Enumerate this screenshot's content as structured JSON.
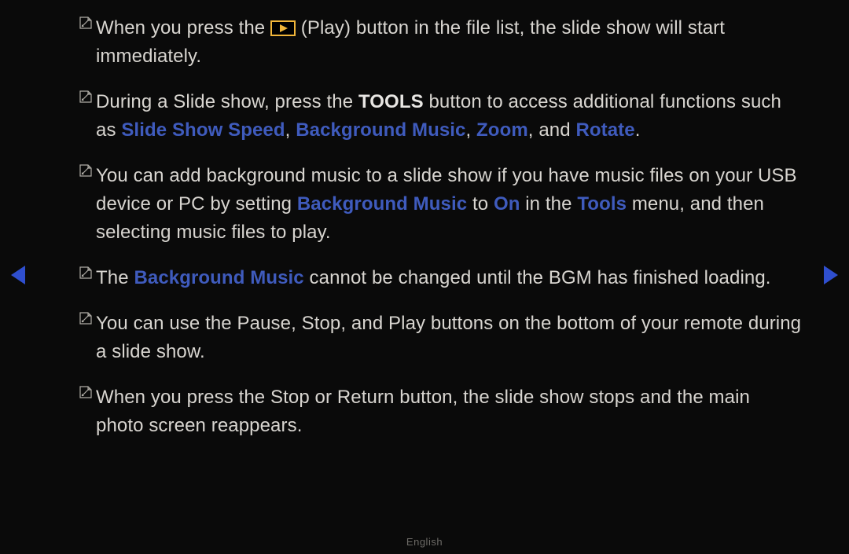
{
  "items": [
    {
      "parts": [
        {
          "t": "text",
          "v": "When you press the "
        },
        {
          "t": "play_icon"
        },
        {
          "t": "text",
          "v": " (Play) button in the file list, the slide show will start immediately."
        }
      ]
    },
    {
      "parts": [
        {
          "t": "text",
          "v": "During a Slide show, press the "
        },
        {
          "t": "bold",
          "v": "TOOLS"
        },
        {
          "t": "text",
          "v": " button to access additional functions such as "
        },
        {
          "t": "hl",
          "v": "Slide Show Speed"
        },
        {
          "t": "text",
          "v": ", "
        },
        {
          "t": "hl",
          "v": "Background Music"
        },
        {
          "t": "text",
          "v": ", "
        },
        {
          "t": "hl",
          "v": "Zoom"
        },
        {
          "t": "text",
          "v": ", and "
        },
        {
          "t": "hl",
          "v": "Rotate"
        },
        {
          "t": "text",
          "v": "."
        }
      ]
    },
    {
      "parts": [
        {
          "t": "text",
          "v": "You can add background music to a slide show if you have music files on your USB device or PC by setting "
        },
        {
          "t": "hl",
          "v": "Background Music"
        },
        {
          "t": "text",
          "v": " to "
        },
        {
          "t": "hl",
          "v": "On"
        },
        {
          "t": "text",
          "v": " in the "
        },
        {
          "t": "hl",
          "v": "Tools"
        },
        {
          "t": "text",
          "v": " menu, and then selecting music files to play."
        }
      ]
    },
    {
      "parts": [
        {
          "t": "text",
          "v": "The "
        },
        {
          "t": "hl",
          "v": "Background Music"
        },
        {
          "t": "text",
          "v": " cannot be changed until the BGM has finished loading."
        }
      ]
    },
    {
      "parts": [
        {
          "t": "text",
          "v": "You can use the Pause, Stop, and Play buttons on the bottom of your remote during a slide show."
        }
      ]
    },
    {
      "parts": [
        {
          "t": "text",
          "v": "When you press the Stop or Return button, the slide show stops and the main photo screen reappears."
        }
      ]
    }
  ],
  "footer": "English"
}
